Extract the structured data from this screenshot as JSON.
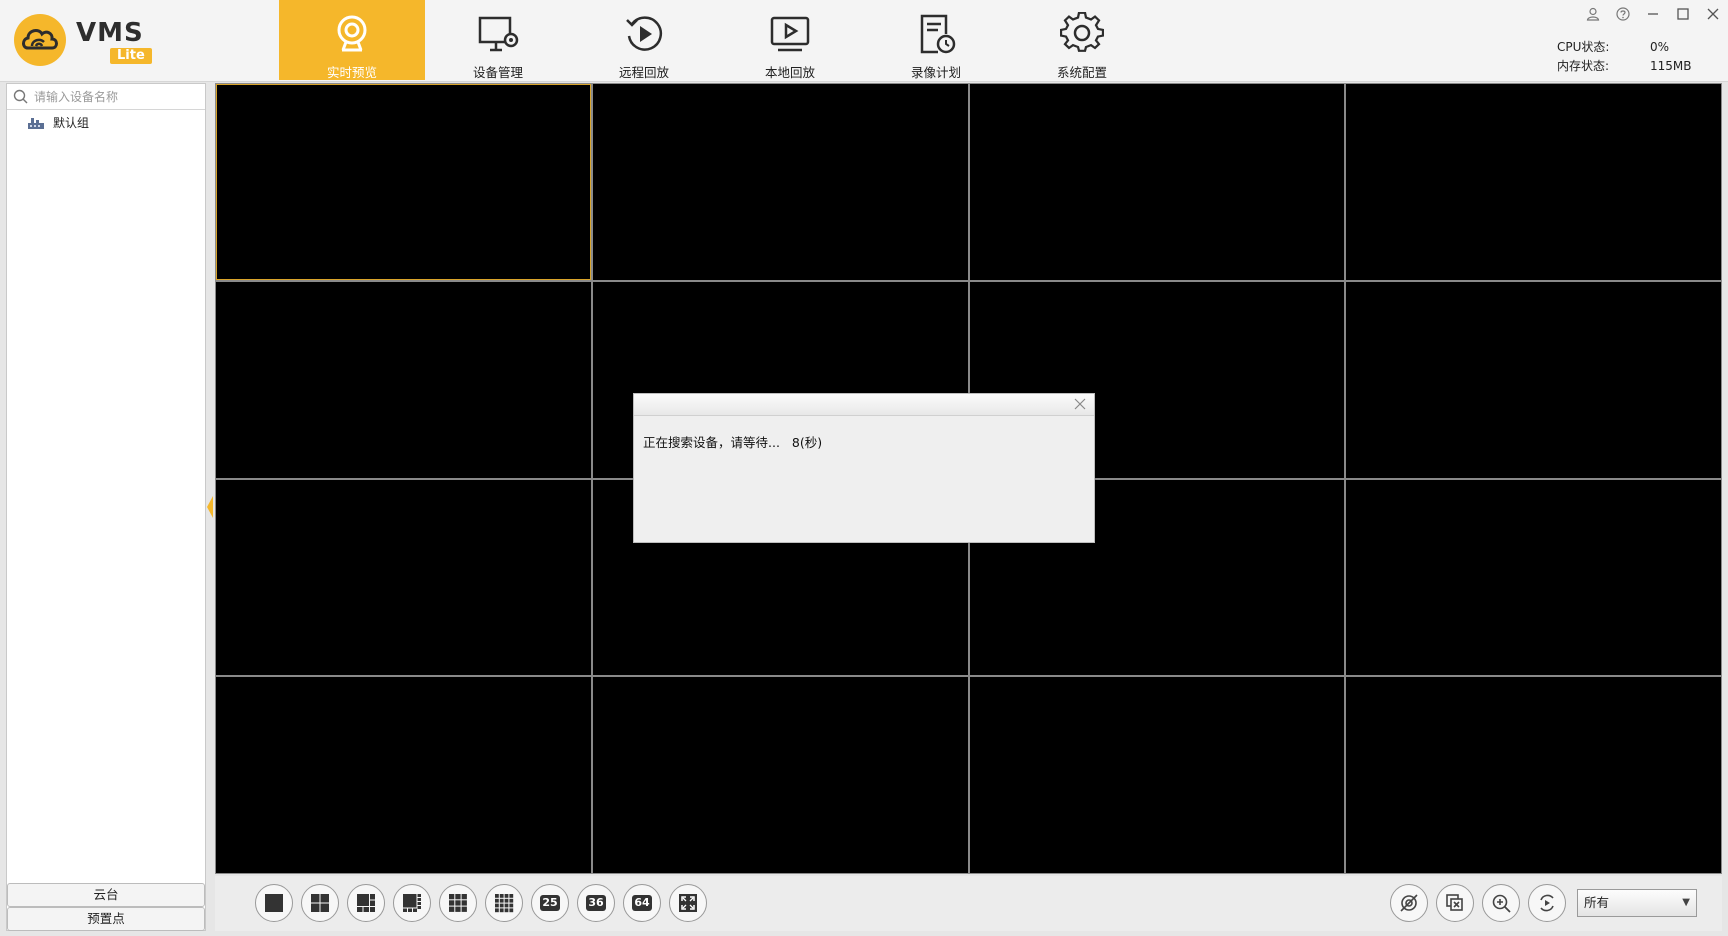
{
  "app": {
    "logo_text": "VMS",
    "logo_sub": "Lite"
  },
  "nav": [
    {
      "label": "实时预览",
      "icon": "camera-icon",
      "active": true
    },
    {
      "label": "设备管理",
      "icon": "monitor-gear-icon",
      "active": false
    },
    {
      "label": "远程回放",
      "icon": "replay-icon",
      "active": false
    },
    {
      "label": "本地回放",
      "icon": "play-screen-icon",
      "active": false
    },
    {
      "label": "录像计划",
      "icon": "schedule-icon",
      "active": false
    },
    {
      "label": "系统配置",
      "icon": "gear-icon",
      "active": false
    }
  ],
  "status": {
    "cpu_label": "CPU状态:",
    "cpu_value": "0%",
    "mem_label": "内存状态:",
    "mem_value": "115MB"
  },
  "sidebar": {
    "search_placeholder": "请输入设备名称",
    "tree": [
      {
        "label": "默认组",
        "icon": "device-group-icon"
      }
    ],
    "ptz_label": "云台",
    "preset_label": "预置点"
  },
  "dialog": {
    "message": "正在搜索设备，请等待...",
    "countdown": "8(秒)"
  },
  "toolbar": {
    "layout_labels": [
      "25",
      "36",
      "64"
    ],
    "stream_select": "所有"
  },
  "colors": {
    "accent": "#f5b72b",
    "video_bg": "#000000",
    "selected_border": "#d9a42a"
  }
}
